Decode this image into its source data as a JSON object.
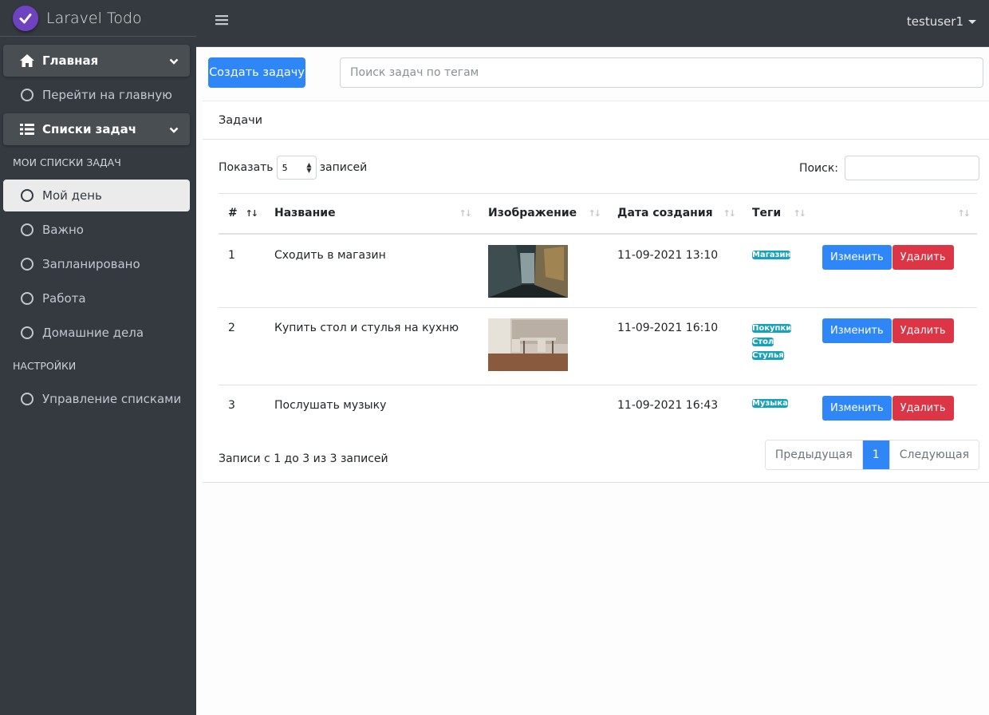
{
  "brand": {
    "title": "Laravel Todo"
  },
  "topbar": {
    "user": "testuser1"
  },
  "sidebar": {
    "group_main": "Главная",
    "go_home": "Перейти на главную",
    "group_lists": "Списки задач",
    "header_my_lists": "МОИ СПИСКИ ЗАДАЧ",
    "items": [
      "Мой день",
      "Важно",
      "Запланировано",
      "Работа",
      "Домашние дела"
    ],
    "header_settings": "НАСТРОЙКИ",
    "manage_lists": "Управление списками"
  },
  "main": {
    "create_button": "Создать задачу",
    "tag_search_placeholder": "Поиск задач по тегам",
    "card_title": "Задачи",
    "show_label": "Показать",
    "show_value": "5",
    "show_suffix": "записей",
    "filter_label": "Поиск:",
    "columns": [
      "#",
      "Название",
      "Изображение",
      "Дата создания",
      "Теги"
    ],
    "rows": [
      {
        "num": "1",
        "title": "Сходить в магазин",
        "date": "11-09-2021 13:10",
        "tags": [
          "Магазин"
        ]
      },
      {
        "num": "2",
        "title": "Купить стол и стулья на кухню",
        "date": "11-09-2021 16:10",
        "tags": [
          "Покупки",
          "Стол",
          "Стулья"
        ]
      },
      {
        "num": "3",
        "title": "Послушать музыку",
        "date": "11-09-2021 16:43",
        "tags": [
          "Музыка"
        ]
      }
    ],
    "edit_label": "Изменить",
    "delete_label": "Удалить",
    "info": "Записи с 1 до 3 из 3 записей",
    "pager": {
      "prev": "Предыдущая",
      "current": "1",
      "next": "Следующая"
    }
  },
  "colors": {
    "primary": "#2f86f6",
    "danger": "#dc3545",
    "info": "#17a2b8",
    "sidebar": "#343a40",
    "brand": "#6f42c1"
  }
}
